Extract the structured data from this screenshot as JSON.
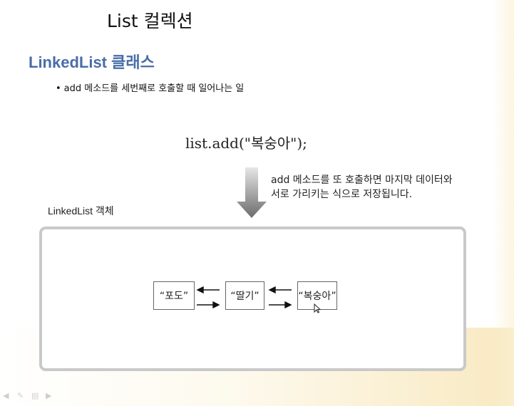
{
  "slide": {
    "title": "List 컬렉션",
    "section_title": "LinkedList 클래스",
    "bullet": "add 메소드를 세번째로 호출할 때 일어나는 일"
  },
  "diagram": {
    "code": "list.add(\"복숭아\");",
    "note_line1": "add 메소드를 또 호출하면 마지막 데이터와",
    "note_line2": "서로 가리키는 식으로 저장됩니다.",
    "object_label": "LinkedList 객체",
    "nodes": [
      {
        "label": "“포도”"
      },
      {
        "label": "“딸기”"
      },
      {
        "label": "“복숭아”"
      }
    ]
  },
  "colors": {
    "section_title": "#4a6da8",
    "frame_border": "#c9c9c9",
    "arrow": "#888888"
  },
  "nav": {
    "icons": [
      "prev-icon",
      "pen-icon",
      "menu-icon",
      "next-icon"
    ]
  }
}
